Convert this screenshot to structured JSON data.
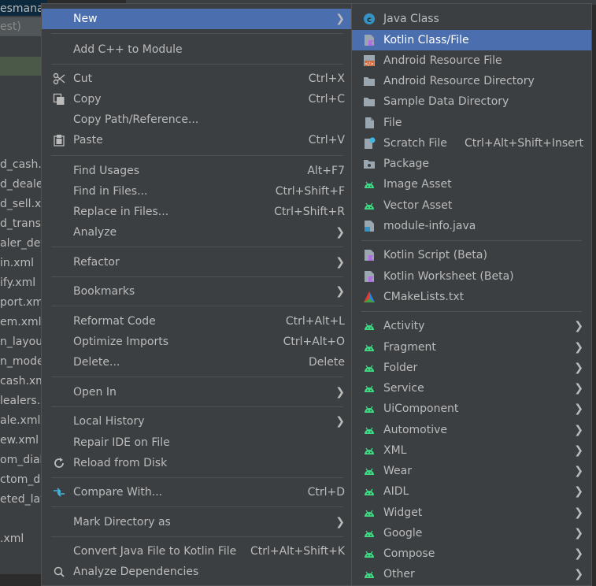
{
  "background": {
    "left_items": [
      "est)",
      "d_cash.x",
      "d_dealer",
      "d_sell.xm",
      "d_transa",
      "aler_deta",
      "in.xml",
      "ify.xml",
      "port.xml",
      "em.xml",
      "n_layout",
      "n_model",
      "cash.xml",
      "lealers.x",
      "ale.xml",
      "ew.xml",
      "om_dialc",
      "ctom_dia",
      "eted_lay",
      ".xml"
    ],
    "editor_top": "esmanag"
  },
  "main_menu": {
    "new": "New",
    "add_cpp": "Add C++ to Module",
    "cut": "Cut",
    "cut_sc": "Ctrl+X",
    "copy": "Copy",
    "copy_sc": "Ctrl+C",
    "copy_path": "Copy Path/Reference...",
    "paste": "Paste",
    "paste_sc": "Ctrl+V",
    "find_usages": "Find Usages",
    "find_usages_sc": "Alt+F7",
    "find_in_files": "Find in Files...",
    "find_in_files_sc": "Ctrl+Shift+F",
    "replace_in_files": "Replace in Files...",
    "replace_in_files_sc": "Ctrl+Shift+R",
    "analyze": "Analyze",
    "refactor": "Refactor",
    "bookmarks": "Bookmarks",
    "reformat_code": "Reformat Code",
    "reformat_code_sc": "Ctrl+Alt+L",
    "optimize_imports": "Optimize Imports",
    "optimize_imports_sc": "Ctrl+Alt+O",
    "delete": "Delete...",
    "delete_sc": "Delete",
    "open_in": "Open In",
    "local_history": "Local History",
    "repair_ide": "Repair IDE on File",
    "reload_disk": "Reload from Disk",
    "compare_with": "Compare With...",
    "compare_with_sc": "Ctrl+D",
    "mark_directory": "Mark Directory as",
    "convert_java": "Convert Java File to Kotlin File",
    "convert_java_sc": "Ctrl+Alt+Shift+K",
    "analyze_deps": "Analyze Dependencies"
  },
  "sub_menu": {
    "java_class": "Java Class",
    "kotlin_class": "Kotlin Class/File",
    "android_resource_file": "Android Resource File",
    "android_resource_dir": "Android Resource Directory",
    "sample_data_dir": "Sample Data Directory",
    "file": "File",
    "scratch_file": "Scratch File",
    "scratch_file_sc": "Ctrl+Alt+Shift+Insert",
    "package": "Package",
    "image_asset": "Image Asset",
    "vector_asset": "Vector Asset",
    "module_info": "module-info.java",
    "kotlin_script": "Kotlin Script (Beta)",
    "kotlin_worksheet": "Kotlin Worksheet (Beta)",
    "cmakelists": "CMakeLists.txt",
    "activity": "Activity",
    "fragment": "Fragment",
    "folder": "Folder",
    "service": "Service",
    "uicomponent": "UiComponent",
    "automotive": "Automotive",
    "xml": "XML",
    "wear": "Wear",
    "aidl": "AIDL",
    "widget": "Widget",
    "google": "Google",
    "compose": "Compose",
    "other": "Other"
  },
  "colors": {
    "menu_bg": "#3c3f41",
    "highlight": "#4b6eaf",
    "android_green": "#3ddc84",
    "text": "#bbbbbb"
  }
}
